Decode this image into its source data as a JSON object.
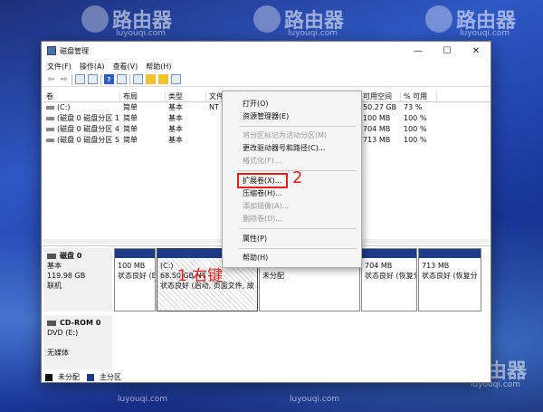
{
  "watermark": {
    "brand": "路由器",
    "url": "luyouqi.com"
  },
  "window": {
    "title": "磁盘管理",
    "controls": {
      "minimize": "—",
      "maximize": "☐",
      "close": "✕"
    },
    "menu": [
      "文件(F)",
      "操作(A)",
      "查看(V)",
      "帮助(H)"
    ]
  },
  "volume_table": {
    "columns": [
      "卷",
      "布局",
      "类型",
      "文件系统",
      "状态",
      "容量",
      "可用空间",
      "% 可用"
    ],
    "rows": [
      {
        "vol": "(C:)",
        "layout": "简单",
        "type": "基本",
        "fs": "NT",
        "free": "50.27 GB",
        "pct": "73 %"
      },
      {
        "vol": "(磁盘 0 磁盘分区 1)",
        "layout": "简单",
        "type": "基本",
        "fs": "",
        "free": "100 MB",
        "pct": "100 %"
      },
      {
        "vol": "(磁盘 0 磁盘分区 4)",
        "layout": "简单",
        "type": "基本",
        "fs": "",
        "free": "704 MB",
        "pct": "100 %"
      },
      {
        "vol": "(磁盘 0 磁盘分区 5)",
        "layout": "简单",
        "type": "基本",
        "fs": "",
        "free": "713 MB",
        "pct": "100 %"
      }
    ]
  },
  "disks": {
    "disk0": {
      "name": "磁盘 0",
      "kind": "基本",
      "size": "119.98 GB",
      "status": "联机"
    },
    "cdrom": {
      "name": "CD-ROM 0",
      "kind": "DVD (E:)",
      "status": "无媒体"
    }
  },
  "partitions": [
    {
      "size": "100 MB",
      "status": "状态良好 (EFI"
    },
    {
      "label": "(C:)",
      "size": "68.50 GB NT",
      "status": "状态良好 (启动, 页面文件, 故"
    },
    {
      "size": "50.00 GB",
      "status": "未分配"
    },
    {
      "size": "704 MB",
      "status": "状态良好 (恢复分"
    },
    {
      "size": "713 MB",
      "status": "状态良好 (恢复分"
    }
  ],
  "legend": {
    "unallocated": "未分配",
    "primary": "主分区"
  },
  "context_menu": {
    "open": "打开(O)",
    "explorer": "资源管理器(E)",
    "mark_active": "将分区标记为活动分区(M)",
    "change_letter": "更改驱动器号和路径(C)...",
    "format": "格式化(F)...",
    "extend": "扩展卷(X)...",
    "shrink": "压缩卷(H)...",
    "add_mirror": "添加镜像(A)...",
    "delete": "删除卷(D)...",
    "properties": "属性(P)",
    "help": "帮助(H)"
  },
  "annotations": {
    "right_click": "1 右键",
    "step2": "2"
  },
  "colors": {
    "primary_partition": "#1e3a8a",
    "highlight": "#e02020"
  }
}
